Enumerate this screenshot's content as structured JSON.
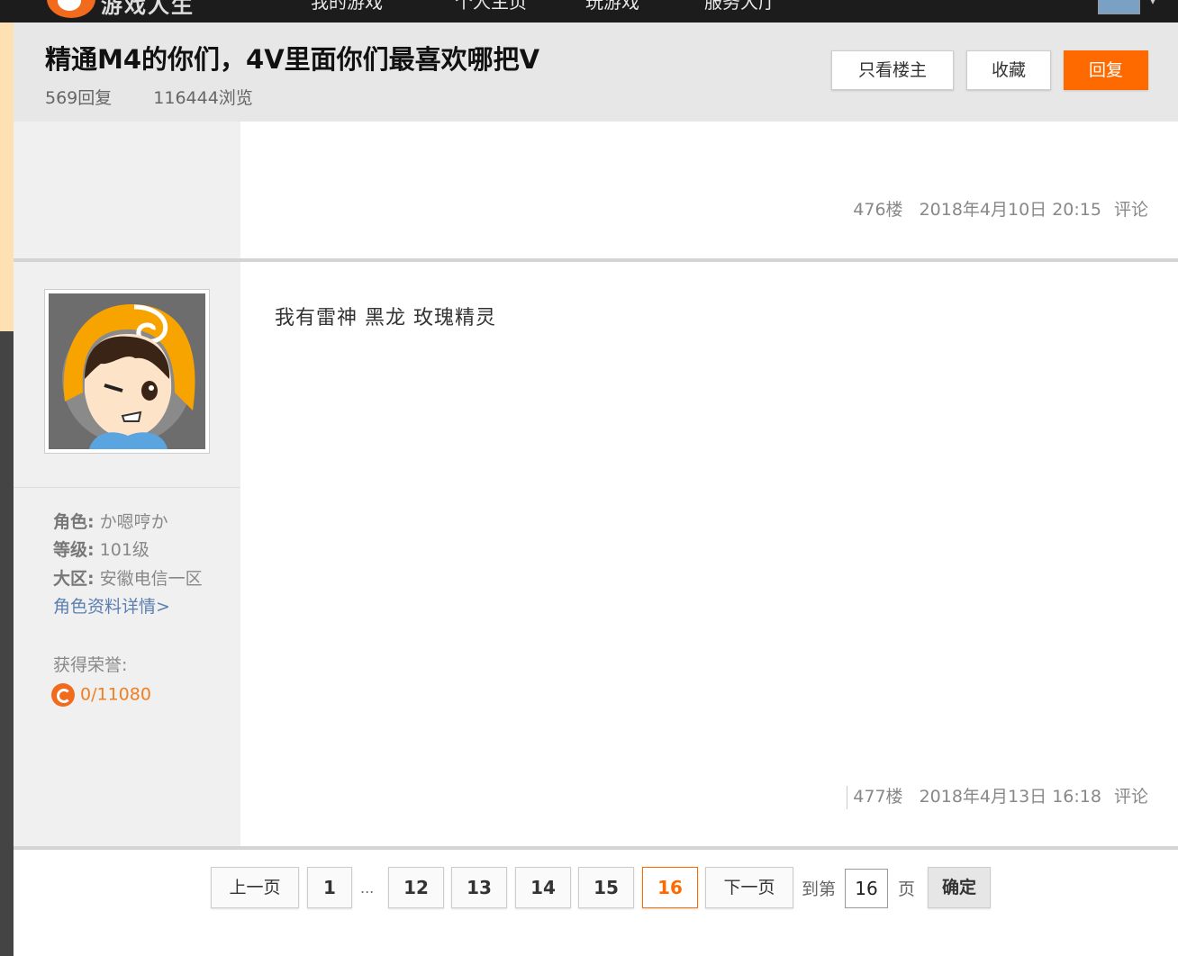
{
  "colors": {
    "accent": "#ff6a00",
    "nav_bg": "#1c1c1c",
    "header_bg": "#e7e7e7",
    "side_bg": "#f0f0f0",
    "link": "#5b7fb0"
  },
  "thread": {
    "title": "精通M4的你们，4V里面你们最喜欢哪把V",
    "replies": "569回复",
    "views": "116444浏览",
    "btn_only_op": "只看楼主",
    "btn_favorite": "收藏",
    "btn_reply": "回复"
  },
  "posts": [
    {
      "floor": "476楼",
      "date": "2018年4月10日 20:15",
      "comment": "评论"
    },
    {
      "content": "我有雷神 黑龙 玫瑰精灵",
      "floor": "477楼",
      "date": "2018年4月13日 16:18",
      "comment": "评论",
      "user": {
        "role_label": "角色:",
        "role": "か嗯哼か",
        "level_label": "等级:",
        "level": "101级",
        "region_label": "大区:",
        "region": "安徽电信一区",
        "detail_link": "角色资料详情>",
        "honor_label": "获得荣誉:",
        "honor_value": "0/11080"
      }
    }
  ],
  "pagination": {
    "prev": "上一页",
    "pages": [
      "1",
      "12",
      "13",
      "14",
      "15",
      "16"
    ],
    "ellipsis": "...",
    "current": "16",
    "next": "下一页",
    "goto_prefix": "到第",
    "goto_value": "16",
    "goto_suffix": "页",
    "confirm": "确定"
  }
}
